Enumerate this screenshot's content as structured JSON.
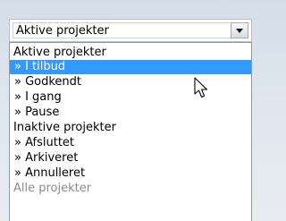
{
  "select": {
    "value": "Aktive projekter"
  },
  "options": [
    {
      "text": "Aktive projekter",
      "kind": "group"
    },
    {
      "text": "» I tilbud",
      "kind": "item",
      "selected": true
    },
    {
      "text": "» Godkendt",
      "kind": "item"
    },
    {
      "text": "» I gang",
      "kind": "item"
    },
    {
      "text": "» Pause",
      "kind": "item"
    },
    {
      "text": "Inaktive projekter",
      "kind": "group"
    },
    {
      "text": "» Afsluttet",
      "kind": "item"
    },
    {
      "text": "» Arkiveret",
      "kind": "item"
    },
    {
      "text": "» Annulleret",
      "kind": "item"
    },
    {
      "text": "Alle projekter",
      "kind": "group",
      "disabled": true
    }
  ],
  "colors": {
    "highlight": "#3399ff",
    "disabled_text": "#8c8c8c"
  },
  "icons": {
    "dropdown_arrow": "chevron-down-icon",
    "pointer": "mouse-pointer-icon"
  }
}
